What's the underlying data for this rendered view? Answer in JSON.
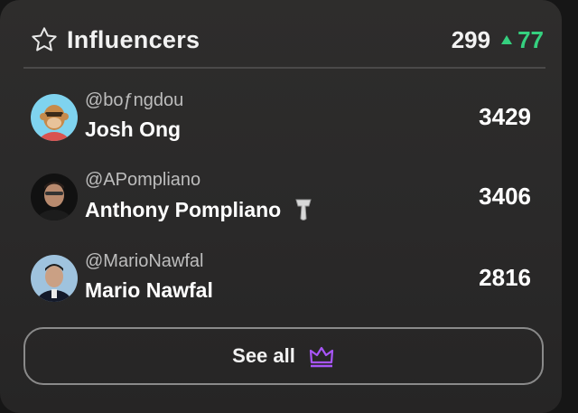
{
  "header": {
    "title": "Influencers",
    "total": "299",
    "delta": "77",
    "star_icon": "star-outline-icon",
    "delta_icon": "triangle-up-icon",
    "delta_color": "#35d07f"
  },
  "influencers": [
    {
      "handle": "@boƒngdou",
      "name": "Josh Ong",
      "score": "3429",
      "avatar_icon": "ape-avatar"
    },
    {
      "handle": "@APompliano",
      "name": "Anthony Pompliano",
      "score": "3406",
      "avatar_icon": "portrait-avatar",
      "badge_icon": "silver-badge-icon"
    },
    {
      "handle": "@MarioNawfal",
      "name": "Mario Nawfal",
      "score": "2816",
      "avatar_icon": "portrait-avatar"
    }
  ],
  "footer": {
    "see_all_label": "See all",
    "crown_icon": "crown-icon",
    "crown_color": "#a855f7"
  }
}
